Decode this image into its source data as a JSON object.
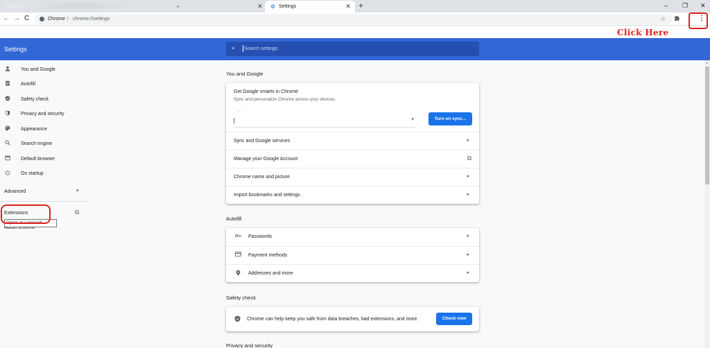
{
  "browser": {
    "inactive_tab_close": "✕",
    "active_tab": {
      "title": "Settings",
      "favicon": "gear-icon",
      "close": "✕"
    },
    "new_tab": "+",
    "window_controls": {
      "minimize": "–",
      "restore": "❐",
      "close": "✕"
    },
    "toolbar": {
      "back": "←",
      "forward": "→",
      "reload": "C",
      "host": "Chrome",
      "separator": "|",
      "url": "chrome://settings",
      "bookmark_icon": "☆",
      "extensions_icon": "puzzle-icon",
      "menu_icon": "⋮"
    }
  },
  "annotation": {
    "click_here": "Click Here",
    "color": "#e0201d"
  },
  "header": {
    "title": "Settings",
    "search_placeholder": "Search settings",
    "color": "#3367d6"
  },
  "sidebar": {
    "items": [
      {
        "label": "You and Google",
        "icon": "person-icon",
        "glyph": "👤"
      },
      {
        "label": "Autofill",
        "icon": "clipboard-icon",
        "glyph": "▤"
      },
      {
        "label": "Safety check",
        "icon": "shield-check-icon",
        "glyph": "⛊"
      },
      {
        "label": "Privacy and security",
        "icon": "shield-icon",
        "glyph": "◈"
      },
      {
        "label": "Appearance",
        "icon": "palette-icon",
        "glyph": "◕"
      },
      {
        "label": "Search engine",
        "icon": "search-icon",
        "glyph": "⌕"
      },
      {
        "label": "Default browser",
        "icon": "browser-icon",
        "glyph": "▭"
      },
      {
        "label": "On startup",
        "icon": "power-icon",
        "glyph": "⏻"
      }
    ],
    "advanced": "Advanced",
    "extensions": "Extensions",
    "extensions_tooltip": "Opens in a new tab",
    "about": "About Chrome"
  },
  "main": {
    "you_and_google": {
      "title": "You and Google",
      "smarts_title": "Get Google smarts in Chrome",
      "smarts_subtitle": "Sync and personalize Chrome across your devices",
      "account_placeholder": "...",
      "sync_button": "Turn on sync...",
      "rows": [
        {
          "label": "Sync and Google services",
          "action": "arrow"
        },
        {
          "label": "Manage your Google Account",
          "action": "external"
        },
        {
          "label": "Chrome name and picture",
          "action": "arrow"
        },
        {
          "label": "Import bookmarks and settings",
          "action": "arrow"
        }
      ]
    },
    "autofill": {
      "title": "Autofill",
      "rows": [
        {
          "label": "Passwords",
          "icon": "key-icon",
          "glyph": "⚷"
        },
        {
          "label": "Payment methods",
          "icon": "credit-card-icon",
          "glyph": "▭"
        },
        {
          "label": "Addresses and more",
          "icon": "location-pin-icon",
          "glyph": "⬤"
        }
      ]
    },
    "safety_check": {
      "title": "Safety check",
      "text": "Chrome can help keep you safe from data breaches, bad extensions, and more",
      "button": "Check now"
    },
    "privacy_title": "Privacy and security"
  },
  "glyphs": {
    "arrow": "▸",
    "external": "⧉",
    "chevron_down": "▾",
    "dropdown": "▾"
  }
}
